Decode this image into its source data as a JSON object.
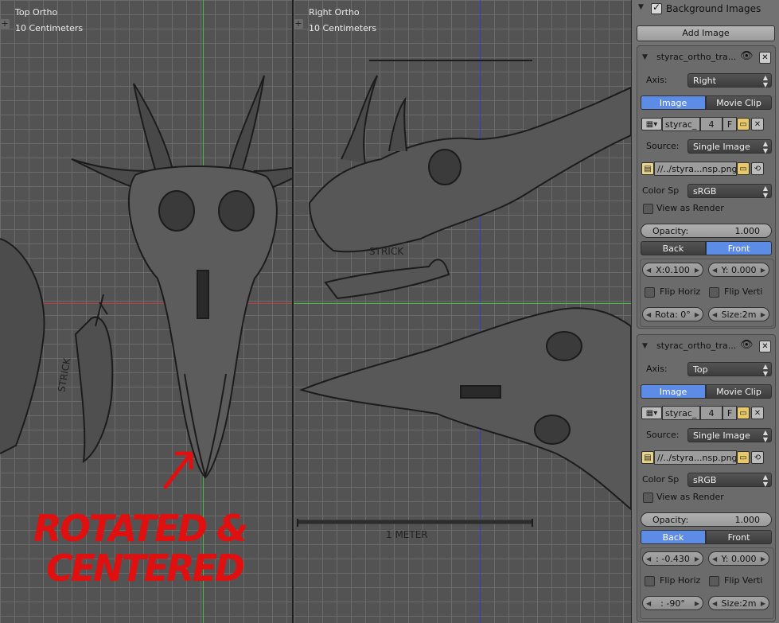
{
  "viewport_top": {
    "title": "Top Ortho",
    "scale": "10 Centimeters",
    "sketch_label": "STRICK"
  },
  "viewport_right": {
    "title": "Right Ortho",
    "scale": "10 Centimeters",
    "sketch_label": "STRICK",
    "scalebar_label": "1 METER"
  },
  "annotation": {
    "line1": "ROTATED &",
    "line2": "CENTERED",
    "color": "#e01010"
  },
  "panel": {
    "header_title": "Background Images",
    "header_checked": true,
    "add_image": "Add Image",
    "images": [
      {
        "name": "styrac_ortho_tra...",
        "axis_label": "Axis:",
        "axis_value": "Right",
        "tab_image": "Image",
        "tab_movie": "Movie Clip",
        "active_tab": "Image",
        "datablock_name": "styrac_",
        "users": "4",
        "fake_user": "F",
        "source_label": "Source:",
        "source_value": "Single Image",
        "filepath": "//../styra...nsp.png",
        "colorspace_label": "Color Sp",
        "colorspace_value": "sRGB",
        "view_as_render": "View as Render",
        "opacity_label": "Opacity:",
        "opacity_value": "1.000",
        "back": "Back",
        "front": "Front",
        "active_depth": "Front",
        "x": "X:0.100",
        "y": "Y: 0.000",
        "flip_h": "Flip Horiz",
        "flip_v": "Flip Verti",
        "rotation": "Rota: 0°",
        "size": "Size:2m"
      },
      {
        "name": "styrac_ortho_tra...",
        "axis_label": "Axis:",
        "axis_value": "Top",
        "tab_image": "Image",
        "tab_movie": "Movie Clip",
        "active_tab": "Image",
        "datablock_name": "styrac_",
        "users": "4",
        "fake_user": "F",
        "source_label": "Source:",
        "source_value": "Single Image",
        "filepath": "//../styra...nsp.png",
        "colorspace_label": "Color Sp",
        "colorspace_value": "sRGB",
        "view_as_render": "View as Render",
        "opacity_label": "Opacity:",
        "opacity_value": "1.000",
        "back": "Back",
        "front": "Front",
        "active_depth": "Back",
        "x": ": -0.430",
        "y": "Y: 0.000",
        "flip_h": "Flip Horiz",
        "flip_v": "Flip Verti",
        "rotation": ": -90°",
        "size": "Size:2m"
      }
    ]
  },
  "colors": {
    "accent": "#5d8ce6",
    "axis_green": "#3fbf3f",
    "axis_red": "#c23a3a",
    "axis_blue": "#3a3ad0",
    "viewport_bg": "#535353",
    "grid": "#6b6b6b"
  }
}
